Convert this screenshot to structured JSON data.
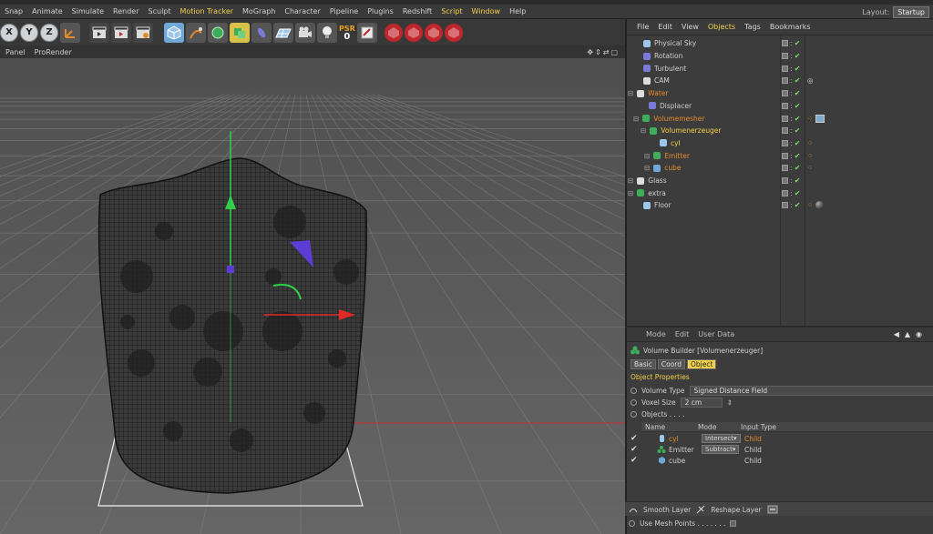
{
  "menu": {
    "items": [
      "Snap",
      "Animate",
      "Simulate",
      "Render",
      "Sculpt",
      "Motion Tracker",
      "MoGraph",
      "Character",
      "Pipeline",
      "Plugins",
      "Redshift",
      "Script",
      "Window",
      "Help"
    ],
    "layout_label": "Layout:",
    "layout_value": "Startup"
  },
  "toolbar": {
    "x_label": "X",
    "y_label": "Y",
    "z_label": "Z",
    "psr_label": "PSR",
    "psr_value": "0"
  },
  "viewport": {
    "menu": [
      "Panel",
      "ProRender"
    ]
  },
  "objects": {
    "tabs": [
      "File",
      "Edit",
      "View",
      "Objects",
      "Tags",
      "Bookmarks"
    ],
    "rows": [
      {
        "name": "Physical Sky",
        "color": "#d0d0d0"
      },
      {
        "name": "Rotation",
        "color": "#d0d0d0"
      },
      {
        "name": "Turbulent",
        "color": "#d0d0d0"
      },
      {
        "name": "CAM",
        "color": "#d0d0d0"
      },
      {
        "name": "Water",
        "color": "#e58a2c"
      },
      {
        "name": "Displacer",
        "color": "#d0d0d0"
      },
      {
        "name": "Volumemesher",
        "color": "#e58a2c"
      },
      {
        "name": "Volumenerzeuger",
        "color": "#f2d14a"
      },
      {
        "name": "cyl",
        "color": "#f2d14a"
      },
      {
        "name": "Emitter",
        "color": "#e58a2c"
      },
      {
        "name": "cube",
        "color": "#e58a2c"
      },
      {
        "name": "Glass",
        "color": "#d0d0d0"
      },
      {
        "name": "extra",
        "color": "#d0d0d0"
      },
      {
        "name": "Floor",
        "color": "#d0d0d0"
      }
    ]
  },
  "attributes": {
    "tabs": [
      "Mode",
      "Edit",
      "User Data"
    ],
    "title": "Volume Builder [Volumenerzeuger]",
    "subtabs": [
      "Basic",
      "Coord",
      "Object"
    ],
    "section": "Object Properties",
    "volume_type_label": "Volume Type",
    "volume_type_value": "Signed Distance Field",
    "voxel_size_label": "Voxel Size",
    "voxel_size_value": "2 cm",
    "objects_label": "Objects . . . .",
    "list_headers": [
      "Name",
      "Mode",
      "Input Type"
    ],
    "list_rows": [
      {
        "name": "cyl",
        "mode": "Intersect",
        "input": "Child"
      },
      {
        "name": "Emitter",
        "mode": "Subtract",
        "input": "Child"
      },
      {
        "name": "cube",
        "mode": "",
        "input": "Child"
      }
    ],
    "layer_buttons": [
      "Smooth Layer",
      "Reshape Layer"
    ],
    "use_mesh_points": "Use Mesh Points . . . . . . ."
  },
  "colors": {
    "accent": "#f2d14a",
    "orange": "#e58a2c",
    "check": "#7ddc6a",
    "viewport_bg": "#5d5d5d"
  }
}
